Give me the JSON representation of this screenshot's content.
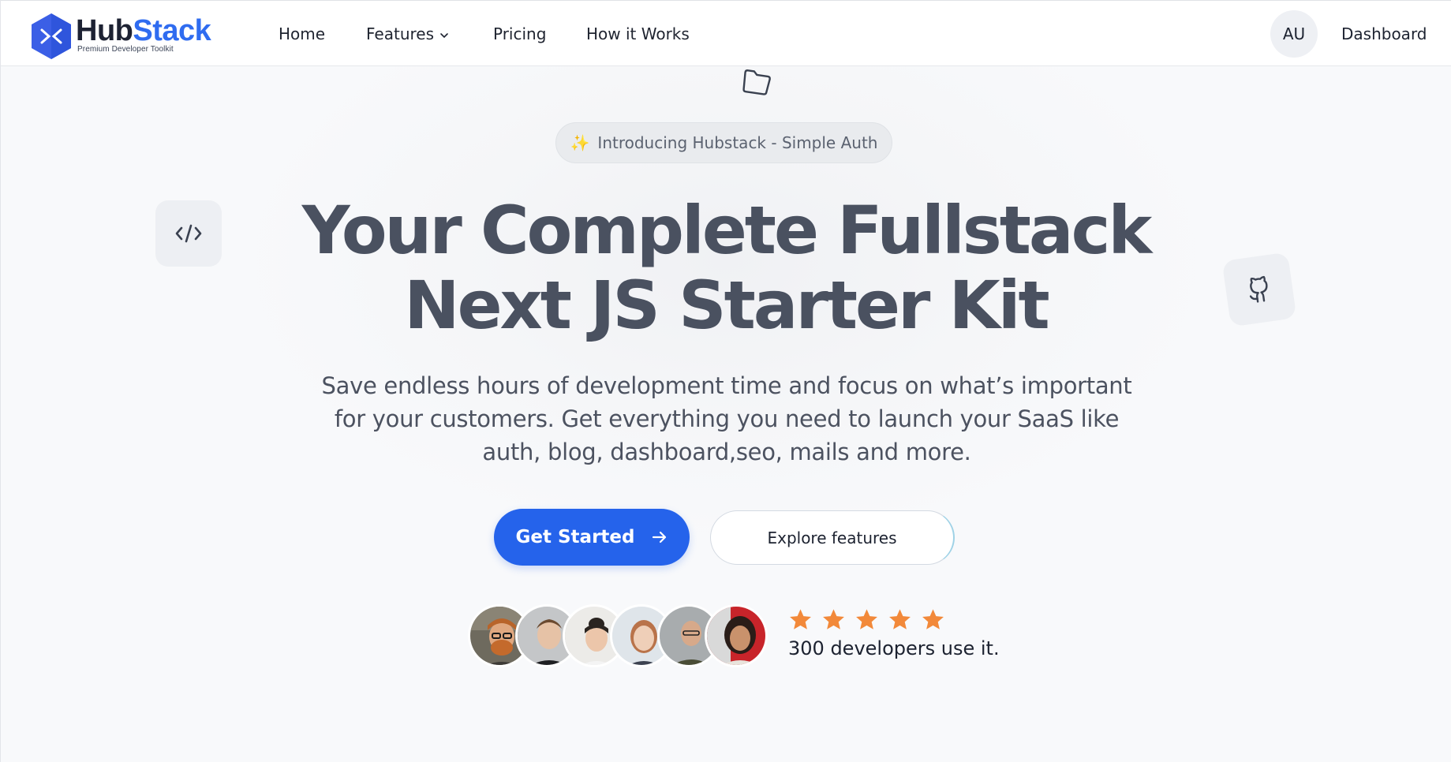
{
  "brand": {
    "name_part1": "Hub",
    "name_part2": "Stack",
    "tagline": "Premium Developer Toolkit",
    "icon": "hubstack-logo-icon",
    "color_primary": "#2f6cf0"
  },
  "nav": {
    "items": [
      {
        "label": "Home"
      },
      {
        "label": "Features",
        "icon": "chevron-down-icon"
      },
      {
        "label": "Pricing"
      },
      {
        "label": "How it Works"
      }
    ],
    "user_initials": "AU",
    "dashboard_label": "Dashboard"
  },
  "hero": {
    "badge": "Introducing Hubstack - Simple Auth",
    "badge_icon": "sparkles-icon",
    "headline_line1": "Your Complete Fullstack",
    "headline_line2": "Next JS Starter Kit",
    "subtitle": "Save endless hours of development time and focus on what’s important for your customers. Get everything you need to launch your SaaS like auth, blog, dashboard,seo, mails and more.",
    "cta_primary": "Get Started",
    "cta_secondary": "Explore features",
    "accent_color": "#2563eb"
  },
  "social_proof": {
    "rating": 5,
    "rating_max": 5,
    "star_color": "#f2893a",
    "text": "300 developers use it.",
    "avatar_count": 6
  },
  "decorations": {
    "icons": [
      "folder-icon",
      "code-icon",
      "github-icon"
    ]
  }
}
